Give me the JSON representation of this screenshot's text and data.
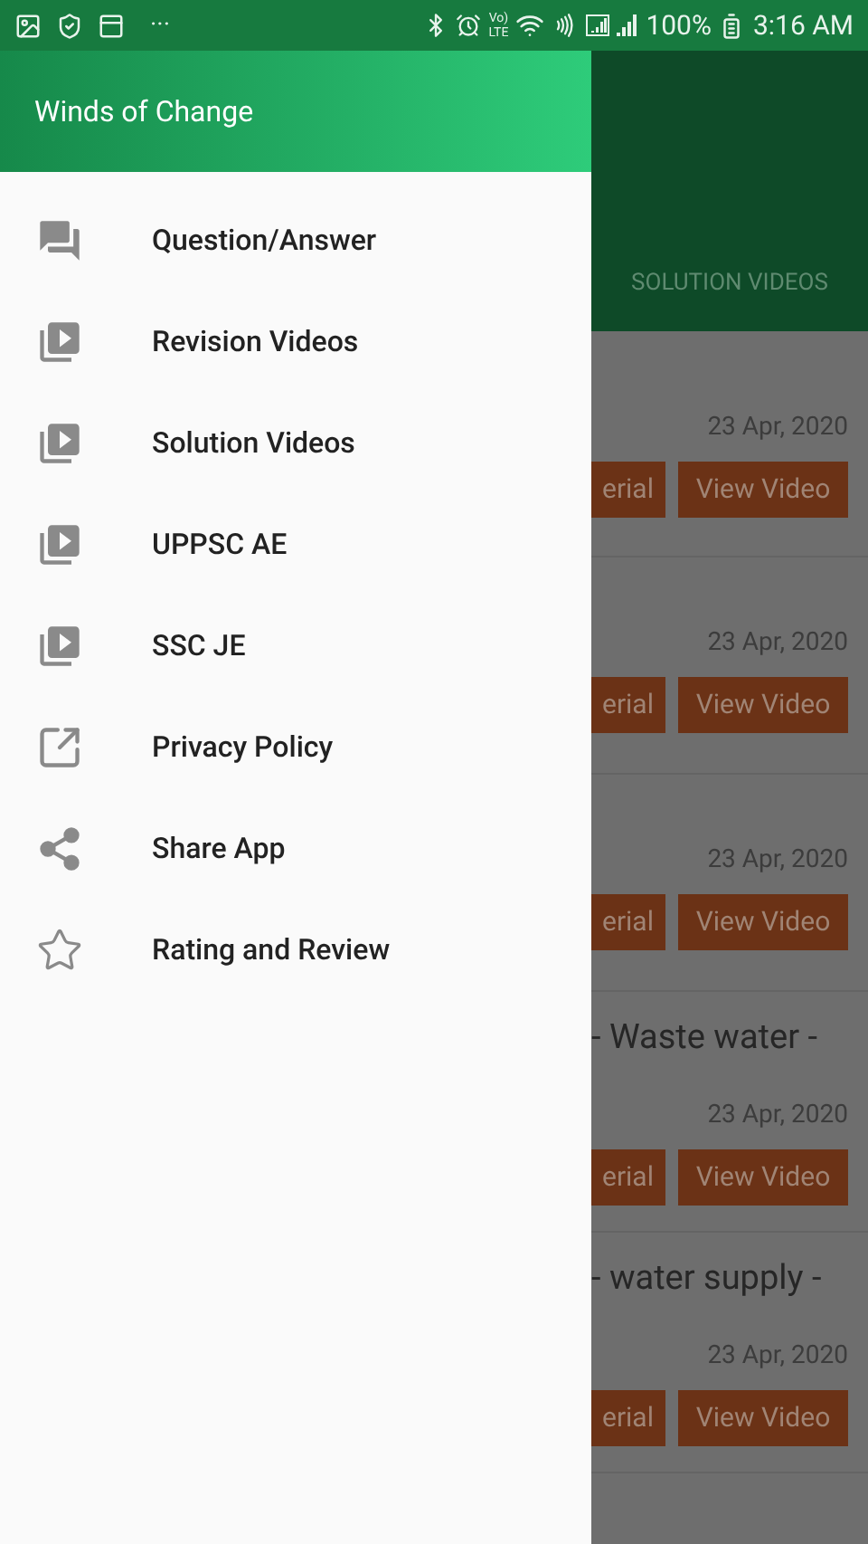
{
  "status_bar": {
    "overflow": "···",
    "volte": [
      "Vo)",
      "LTE"
    ],
    "battery": "100%",
    "time": "3:16 AM"
  },
  "drawer": {
    "title": "Winds of Change",
    "items": [
      {
        "label": "Question/Answer",
        "kind": "chat"
      },
      {
        "label": "Revision Videos",
        "kind": "video"
      },
      {
        "label": "Solution Videos",
        "kind": "video"
      },
      {
        "label": "UPPSC AE",
        "kind": "video"
      },
      {
        "label": "SSC JE",
        "kind": "video"
      },
      {
        "label": "Privacy Policy",
        "kind": "external"
      },
      {
        "label": "Share App",
        "kind": "share"
      },
      {
        "label": "Rating and Review",
        "kind": "star"
      }
    ]
  },
  "background": {
    "tab": "SOLUTION VIDEOS",
    "cards": [
      {
        "date": "23 Apr, 2020",
        "buttons": [
          "erial",
          "View Video"
        ]
      },
      {
        "date": "23 Apr, 2020",
        "buttons": [
          "erial",
          "View Video"
        ]
      },
      {
        "date": "23 Apr, 2020",
        "buttons": [
          "erial",
          "View Video"
        ]
      },
      {
        "title": "- Waste water -",
        "date": "23 Apr, 2020",
        "buttons": [
          "erial",
          "View Video"
        ]
      },
      {
        "title": "- water supply -",
        "date": "23 Apr, 2020",
        "buttons": [
          "erial",
          "View Video"
        ]
      }
    ]
  }
}
